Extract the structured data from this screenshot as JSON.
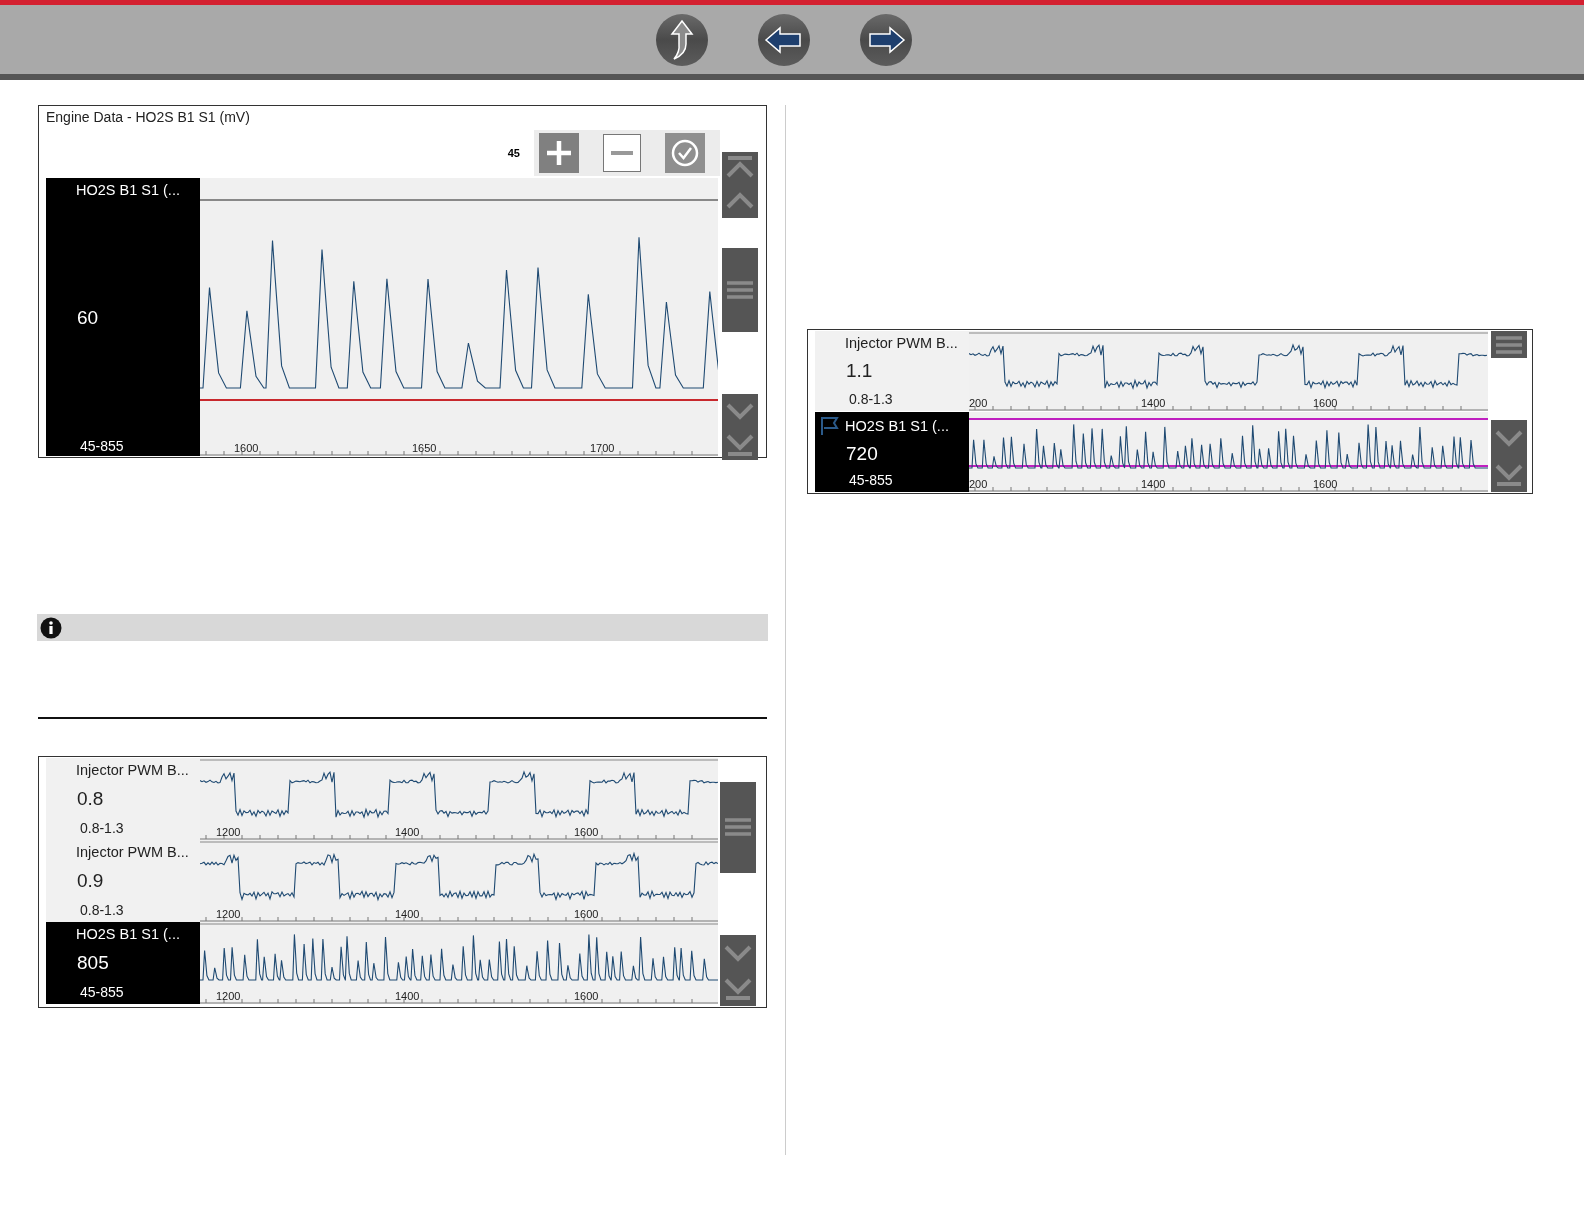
{
  "nav_buttons": [
    {
      "kind": "up"
    },
    {
      "kind": "back"
    },
    {
      "kind": "forward"
    }
  ],
  "left_column": {
    "top_figure": {
      "title": "Engine Data - HO2S B1 S1 (mV)",
      "zoom_value": "45",
      "traces": [
        {
          "name": "HO2S B1 S1 (...",
          "value": "60",
          "range": "45-855",
          "selected": true,
          "flagged": false,
          "kind": "spikes",
          "min_limit": true,
          "max_limit": false,
          "ticks": [
            "1600",
            "1650",
            "1700"
          ]
        }
      ]
    },
    "bottom_figure": {
      "traces": [
        {
          "name": "Injector PWM B...",
          "value": "0.8",
          "range": "0.8-1.3",
          "selected": false,
          "flagged": false,
          "kind": "steps",
          "min_limit": false,
          "max_limit": false,
          "ticks": [
            "1200",
            "1400",
            "1600"
          ]
        },
        {
          "name": "Injector PWM B...",
          "value": "0.9",
          "range": "0.8-1.3",
          "selected": false,
          "flagged": false,
          "kind": "steps",
          "min_limit": false,
          "max_limit": false,
          "ticks": [
            "1200",
            "1400",
            "1600"
          ]
        },
        {
          "name": "HO2S B1 S1 (...",
          "value": "805",
          "range": "45-855",
          "selected": true,
          "flagged": false,
          "kind": "dense",
          "min_limit": false,
          "max_limit": false,
          "ticks": [
            "1200",
            "1400",
            "1600"
          ]
        }
      ]
    }
  },
  "right_column": {
    "figure": {
      "traces": [
        {
          "name": "Injector PWM B...",
          "value": "1.1",
          "range": "0.8-1.3",
          "selected": false,
          "flagged": false,
          "kind": "steps",
          "min_limit": false,
          "max_limit": false,
          "ticks": [
            "200",
            "1400",
            "1600"
          ]
        },
        {
          "name": "HO2S B1 S1 (...",
          "value": "720",
          "range": "45-855",
          "selected": true,
          "flagged": true,
          "kind": "dense",
          "min_limit": true,
          "max_limit": true,
          "ticks": [
            "200",
            "1400",
            "1600"
          ]
        }
      ]
    }
  }
}
